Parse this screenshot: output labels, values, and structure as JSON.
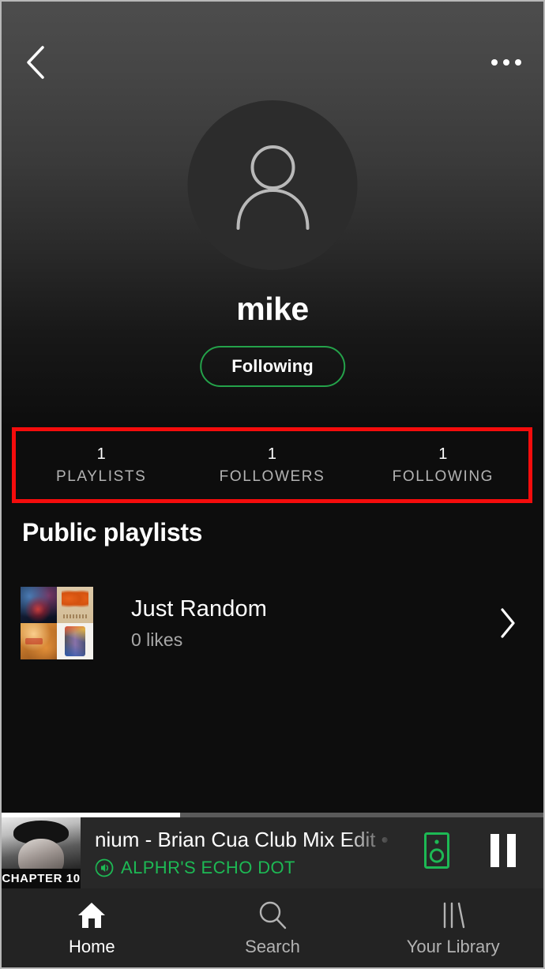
{
  "header": {
    "back_icon": "chevron-left-icon",
    "more_icon": "more-options-icon"
  },
  "profile": {
    "avatar_icon": "person-avatar-icon",
    "display_name": "mike",
    "follow_button_label": "Following",
    "follow_button_border_color": "#24a24a"
  },
  "stats": {
    "highlight_color": "#f40c0c",
    "items": [
      {
        "value": "1",
        "label": "PLAYLISTS"
      },
      {
        "value": "1",
        "label": "FOLLOWERS"
      },
      {
        "value": "1",
        "label": "FOLLOWING"
      }
    ]
  },
  "playlists": {
    "section_title": "Public playlists",
    "items": [
      {
        "name": "Just Random",
        "likes": "0 likes",
        "chevron_icon": "chevron-right-icon"
      }
    ]
  },
  "now_playing": {
    "art_caption": "CHAPTER 10",
    "track_title": "nium - Brian Cua Club Mix Edit • Ch",
    "device_label": "ALPHR'S ECHO DOT",
    "device_accent_color": "#1db954",
    "device_icon": "speaker-icon",
    "connected_icon": "volume-speaker-icon",
    "playpause_icon": "pause-icon",
    "progress_percent": 33
  },
  "bottom_nav": {
    "items": [
      {
        "label": "Home",
        "icon": "home-icon",
        "active": true
      },
      {
        "label": "Search",
        "icon": "search-icon",
        "active": false
      },
      {
        "label": "Your Library",
        "icon": "library-icon",
        "active": false
      }
    ]
  }
}
